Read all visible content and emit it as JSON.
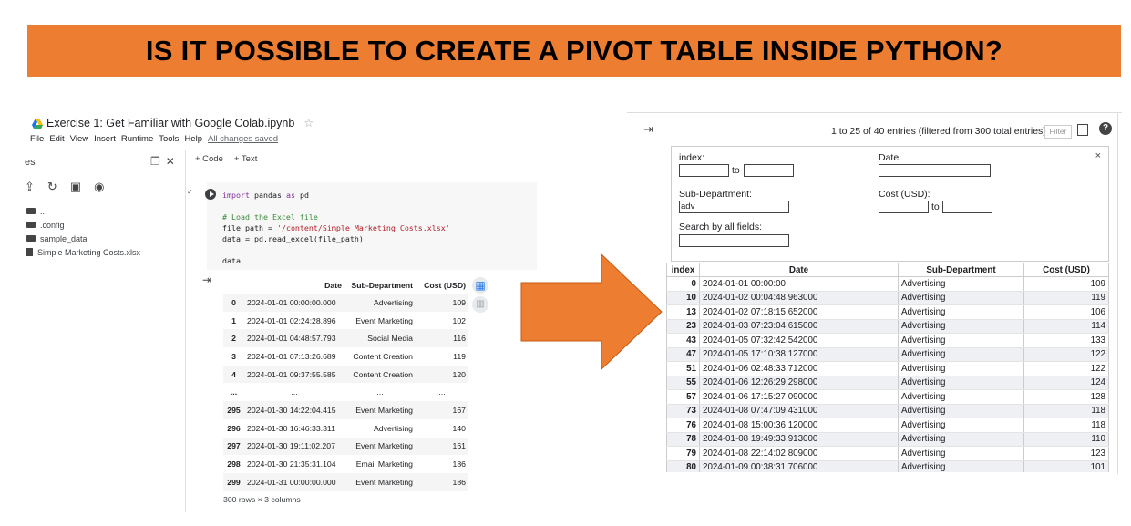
{
  "banner": {
    "title": "IS IT POSSIBLE TO CREATE A PIVOT TABLE INSIDE PYTHON?"
  },
  "colab": {
    "notebook_title": "Exercise 1: Get Familiar with Google Colab.ipynb",
    "menu": [
      "File",
      "Edit",
      "View",
      "Insert",
      "Runtime",
      "Tools",
      "Help"
    ],
    "saved_status": "All changes saved",
    "sidebar": {
      "header": "es",
      "files": [
        {
          "name": "..",
          "type": "folder"
        },
        {
          "name": ".config",
          "type": "folder"
        },
        {
          "name": "sample_data",
          "type": "folder"
        },
        {
          "name": "Simple Marketing Costs.xlsx",
          "type": "file"
        }
      ]
    },
    "toolbar": {
      "code_label": "+ Code",
      "text_label": "+ Text"
    },
    "code": {
      "line1_kw": "import",
      "line1_rest": " pandas ",
      "line1_kw2": "as",
      "line1_end": " pd",
      "comment": "# Load the Excel file",
      "fp_var": "file_path = ",
      "fp_str": "'/content/Simple Marketing Costs.xlsx'",
      "read_line": "data = pd.read_excel(file_path)",
      "display_line": "data"
    },
    "dataframe": {
      "columns": [
        "Date",
        "Sub-Department",
        "Cost (USD)"
      ],
      "rows": [
        {
          "idx": "0",
          "date": "2024-01-01 00:00:00.000",
          "sub": "Advertising",
          "cost": "109"
        },
        {
          "idx": "1",
          "date": "2024-01-01 02:24:28.896",
          "sub": "Event Marketing",
          "cost": "102"
        },
        {
          "idx": "2",
          "date": "2024-01-01 04:48:57.793",
          "sub": "Social Media",
          "cost": "116"
        },
        {
          "idx": "3",
          "date": "2024-01-01 07:13:26.689",
          "sub": "Content Creation",
          "cost": "119"
        },
        {
          "idx": "4",
          "date": "2024-01-01 09:37:55.585",
          "sub": "Content Creation",
          "cost": "120"
        },
        {
          "idx": "...",
          "date": "...",
          "sub": "...",
          "cost": "..."
        },
        {
          "idx": "295",
          "date": "2024-01-30 14:22:04.415",
          "sub": "Event Marketing",
          "cost": "167"
        },
        {
          "idx": "296",
          "date": "2024-01-30 16:46:33.311",
          "sub": "Advertising",
          "cost": "140"
        },
        {
          "idx": "297",
          "date": "2024-01-30 19:11:02.207",
          "sub": "Event Marketing",
          "cost": "161"
        },
        {
          "idx": "298",
          "date": "2024-01-30 21:35:31.104",
          "sub": "Email Marketing",
          "cost": "186"
        },
        {
          "idx": "299",
          "date": "2024-01-31 00:00:00.000",
          "sub": "Event Marketing",
          "cost": "186"
        }
      ],
      "footer": "300 rows × 3 columns"
    }
  },
  "itable": {
    "info": "1 to 25 of 40 entries (filtered from 300 total entries)",
    "filter_button": "Filter",
    "filters": {
      "index_label": "index:",
      "date_label": "Date:",
      "subdept_label": "Sub-Department:",
      "subdept_value": "adv",
      "cost_label": "Cost (USD):",
      "search_label": "Search by all fields:",
      "to_label": "to",
      "close": "×"
    },
    "columns": [
      "index",
      "Date",
      "Sub-Department",
      "Cost (USD)"
    ],
    "rows": [
      {
        "idx": "0",
        "date": "2024-01-01 00:00:00",
        "sub": "Advertising",
        "cost": "109"
      },
      {
        "idx": "10",
        "date": "2024-01-02 00:04:48.963000",
        "sub": "Advertising",
        "cost": "119"
      },
      {
        "idx": "13",
        "date": "2024-01-02 07:18:15.652000",
        "sub": "Advertising",
        "cost": "106"
      },
      {
        "idx": "23",
        "date": "2024-01-03 07:23:04.615000",
        "sub": "Advertising",
        "cost": "114"
      },
      {
        "idx": "43",
        "date": "2024-01-05 07:32:42.542000",
        "sub": "Advertising",
        "cost": "133"
      },
      {
        "idx": "47",
        "date": "2024-01-05 17:10:38.127000",
        "sub": "Advertising",
        "cost": "122"
      },
      {
        "idx": "51",
        "date": "2024-01-06 02:48:33.712000",
        "sub": "Advertising",
        "cost": "122"
      },
      {
        "idx": "55",
        "date": "2024-01-06 12:26:29.298000",
        "sub": "Advertising",
        "cost": "124"
      },
      {
        "idx": "57",
        "date": "2024-01-06 17:15:27.090000",
        "sub": "Advertising",
        "cost": "128"
      },
      {
        "idx": "73",
        "date": "2024-01-08 07:47:09.431000",
        "sub": "Advertising",
        "cost": "118"
      },
      {
        "idx": "76",
        "date": "2024-01-08 15:00:36.120000",
        "sub": "Advertising",
        "cost": "118"
      },
      {
        "idx": "78",
        "date": "2024-01-08 19:49:33.913000",
        "sub": "Advertising",
        "cost": "110"
      },
      {
        "idx": "79",
        "date": "2024-01-08 22:14:02.809000",
        "sub": "Advertising",
        "cost": "123"
      },
      {
        "idx": "80",
        "date": "2024-01-09 00:38:31.706000",
        "sub": "Advertising",
        "cost": "101"
      }
    ]
  },
  "colors": {
    "banner": "#ed7d31",
    "arrow": "#ed7d31",
    "arrow_outline": "#c55a11"
  }
}
